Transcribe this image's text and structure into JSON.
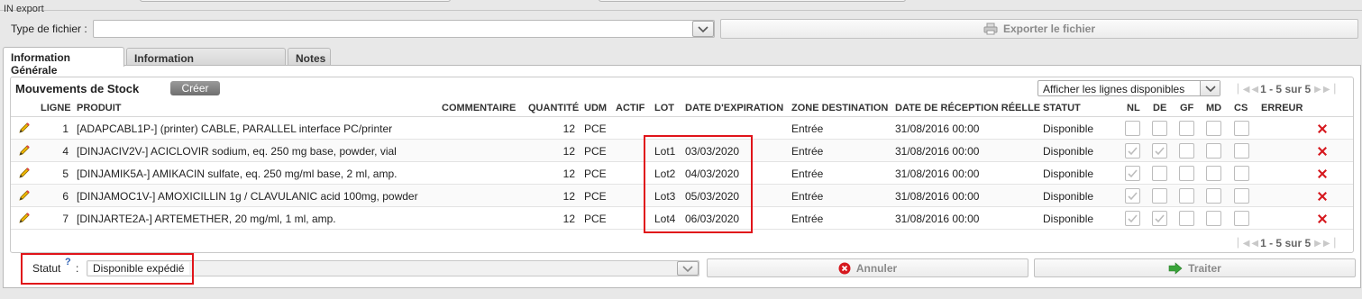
{
  "export": {
    "legend": "IN export",
    "type_label": "Type de fichier :",
    "type_value": "",
    "export_button": "Exporter le fichier"
  },
  "tabs": [
    {
      "label": "Information Générale",
      "active": true
    },
    {
      "label": "Information Complémentaire",
      "active": false
    },
    {
      "label": "Notes",
      "active": false
    }
  ],
  "grid": {
    "title": "Mouvements de Stock",
    "create_button": "Créer",
    "filter_value": "Afficher les lignes disponibles",
    "pager_text": "1 - 5 sur 5",
    "columns": [
      "LIGNE",
      "PRODUIT",
      "COMMENTAIRE",
      "QUANTITÉ",
      "UDM",
      "ACTIF",
      "LOT",
      "DATE D'EXPIRATION",
      "ZONE DESTINATION",
      "DATE DE RÉCEPTION RÉELLE",
      "STATUT",
      "NL",
      "DE",
      "GF",
      "MD",
      "CS",
      "ERREUR"
    ],
    "rows": [
      {
        "ligne": "1",
        "produit": "[ADAPCABL1P-] (printer) CABLE, PARALLEL interface PC/printer",
        "commentaire": "",
        "quantite": "12",
        "udm": "PCE",
        "actif": "",
        "lot": "",
        "expiration": "",
        "zone": "Entrée",
        "reception": "31/08/2016 00:00",
        "statut": "Disponible",
        "nl": false,
        "de": false
      },
      {
        "ligne": "4",
        "produit": "[DINJACIV2V-] ACICLOVIR sodium, eq. 250 mg base, powder, vial",
        "commentaire": "",
        "quantite": "12",
        "udm": "PCE",
        "actif": "",
        "lot": "Lot1",
        "expiration": "03/03/2020",
        "zone": "Entrée",
        "reception": "31/08/2016 00:00",
        "statut": "Disponible",
        "nl": true,
        "de": true
      },
      {
        "ligne": "5",
        "produit": "[DINJAMIK5A-] AMIKACIN sulfate, eq. 250 mg/ml base, 2 ml, amp.",
        "commentaire": "",
        "quantite": "12",
        "udm": "PCE",
        "actif": "",
        "lot": "Lot2",
        "expiration": "04/03/2020",
        "zone": "Entrée",
        "reception": "31/08/2016 00:00",
        "statut": "Disponible",
        "nl": true,
        "de": false
      },
      {
        "ligne": "6",
        "produit": "[DINJAMOC1V-] AMOXICILLIN 1g / CLAVULANIC acid 100mg, powder",
        "commentaire": "",
        "quantite": "12",
        "udm": "PCE",
        "actif": "",
        "lot": "Lot3",
        "expiration": "05/03/2020",
        "zone": "Entrée",
        "reception": "31/08/2016 00:00",
        "statut": "Disponible",
        "nl": true,
        "de": false
      },
      {
        "ligne": "7",
        "produit": "[DINJARTE2A-] ARTEMETHER, 20 mg/ml, 1 ml, amp.",
        "commentaire": "",
        "quantite": "12",
        "udm": "PCE",
        "actif": "",
        "lot": "Lot4",
        "expiration": "06/03/2020",
        "zone": "Entrée",
        "reception": "31/08/2016 00:00",
        "statut": "Disponible",
        "nl": true,
        "de": true
      }
    ]
  },
  "footer": {
    "statut_label": "Statut",
    "help_mark": "?",
    "colon": ":",
    "statut_value": "Disponible expédié",
    "cancel_button": "Annuler",
    "process_button": "Traiter"
  },
  "colors": {
    "highlight": "#e0141a",
    "delete": "#d6181e",
    "ok": "#3aa43a"
  }
}
